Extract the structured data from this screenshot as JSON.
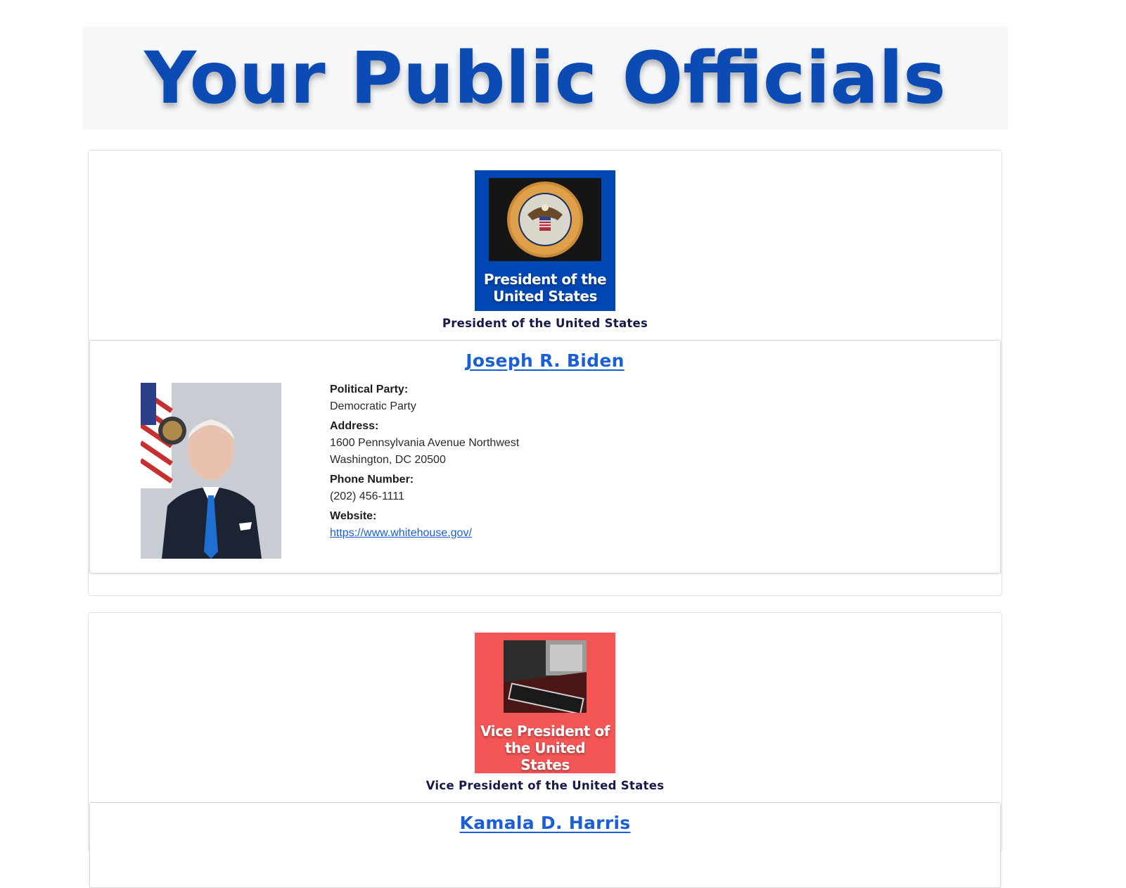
{
  "banner": {
    "title": "Your Public Officials"
  },
  "offices": [
    {
      "logo_text": "President of the United States",
      "logo_color": "#0047b3",
      "name": "President of the United States",
      "official": {
        "name": "Joseph R. Biden",
        "party_label": "Political Party:",
        "party": "Democratic Party",
        "address_label": "Address:",
        "address_line1": "1600 Pennsylvania Avenue Northwest",
        "address_line2": "Washington, DC 20500",
        "phone_label": "Phone Number:",
        "phone": "(202) 456-1111",
        "website_label": "Website:",
        "website": "https://www.whitehouse.gov/"
      }
    },
    {
      "logo_text": "Vice President of the United States",
      "logo_color": "#f45656",
      "name": "Vice President of the United States",
      "official": {
        "name": "Kamala D. Harris"
      }
    }
  ]
}
